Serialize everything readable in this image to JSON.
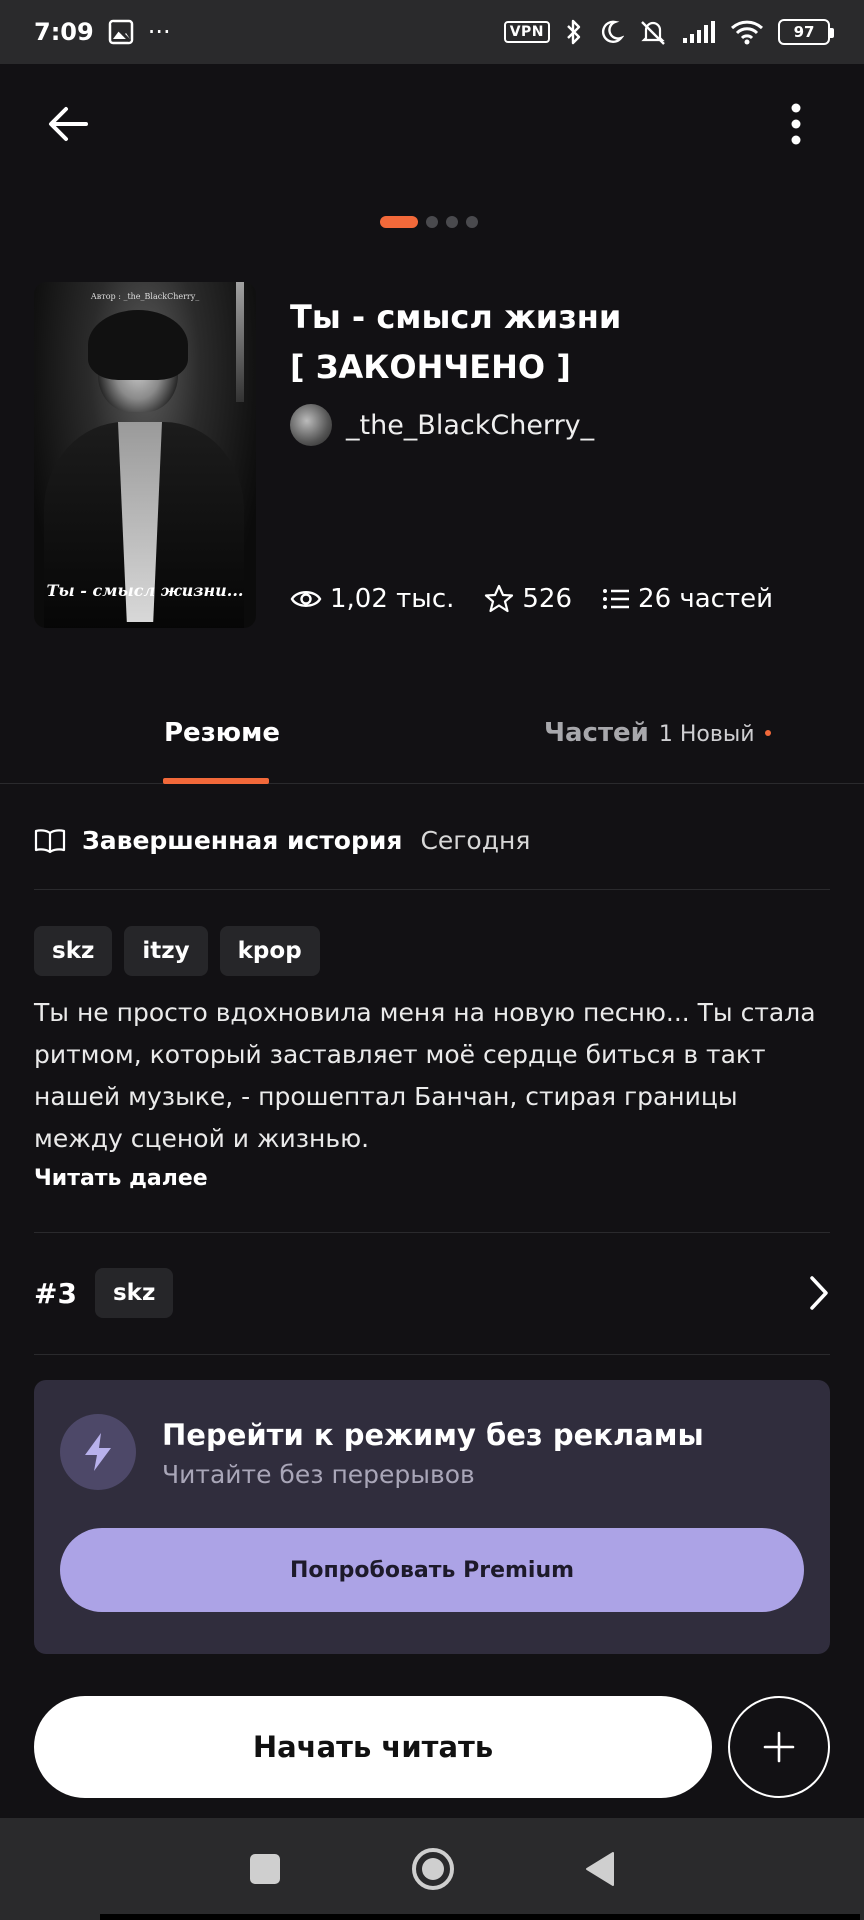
{
  "status_bar": {
    "time": "7:09",
    "more": "···",
    "vpn": "VPN",
    "battery": "97"
  },
  "book": {
    "title_line1": "Ты - смысл жизни",
    "title_line2": "[ ЗАКОНЧЕНО ]",
    "author": "_the_BlackCherry_",
    "cover_author_text": "Автор : _the_BlackCherry_",
    "cover_caption": "Ты - смысл жизни...",
    "views": "1,02 тыс.",
    "stars": "526",
    "parts": "26 частей"
  },
  "carousel": {
    "count": 4,
    "active": 0
  },
  "tabs": {
    "resume": "Резюме",
    "parts": "Частей",
    "parts_new": "1 Новый"
  },
  "story_status": {
    "label": "Завершенная история",
    "date": "Сегодня"
  },
  "tags": [
    "skz",
    "itzy",
    "kpop"
  ],
  "description": "Ты не просто вдохновила меня на новую песню... Ты стала ритмом, который заставляет моё сердце биться в такт нашей музыке, - прошептал Банчан, стирая границы между сценой и жизнью.",
  "read_more": "Читать далее",
  "ranking": {
    "rank": "#3",
    "tag": "skz"
  },
  "premium": {
    "title": "Перейти к режиму без рекламы",
    "subtitle": "Читайте без перерывов",
    "button": "Попробовать Premium"
  },
  "actions": {
    "start_reading": "Начать читать"
  },
  "colors": {
    "accent": "#f2693a",
    "premium_button": "#aca3e6",
    "premium_card": "#302d3d",
    "background": "#121114"
  }
}
